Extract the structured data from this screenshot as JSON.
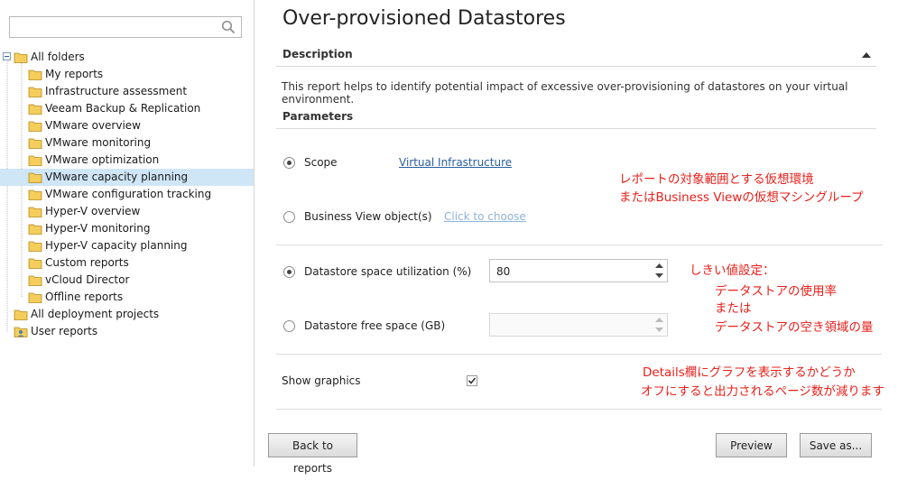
{
  "sidebar": {
    "search": {
      "value": "",
      "placeholder": ""
    },
    "tree": [
      {
        "label": "All folders",
        "level": 0,
        "expanded": true
      },
      {
        "label": "My reports",
        "level": 1
      },
      {
        "label": "Infrastructure assessment",
        "level": 1
      },
      {
        "label": "Veeam Backup & Replication",
        "level": 1
      },
      {
        "label": "VMware overview",
        "level": 1
      },
      {
        "label": "VMware monitoring",
        "level": 1
      },
      {
        "label": "VMware optimization",
        "level": 1
      },
      {
        "label": "VMware capacity planning",
        "level": 1,
        "selected": true
      },
      {
        "label": "VMware configuration tracking",
        "level": 1
      },
      {
        "label": "Hyper-V overview",
        "level": 1
      },
      {
        "label": "Hyper-V monitoring",
        "level": 1
      },
      {
        "label": "Hyper-V capacity planning",
        "level": 1
      },
      {
        "label": "Custom reports",
        "level": 1
      },
      {
        "label": "vCloud Director",
        "level": 1
      },
      {
        "label": "Offline reports",
        "level": 1
      },
      {
        "label": "All deployment projects",
        "level": 0
      },
      {
        "label": "User reports",
        "level": 0,
        "icon": "user-folder"
      }
    ]
  },
  "main": {
    "title": "Over-provisioned Datastores",
    "description": {
      "header": "Description",
      "text": "This report helps to identify potential impact of excessive over-provisioning of datastores on your virtual environment."
    },
    "parameters": {
      "header": "Parameters",
      "scope_label": "Scope",
      "scope_link": "Virtual Infrastructure",
      "bv_label": "Business View object(s)",
      "bv_link": "Click to choose",
      "util_label": "Datastore space utilization (%)",
      "util_value": "80",
      "free_label": "Datastore free space (GB)",
      "free_value": "",
      "graphics_label": "Show graphics",
      "graphics_checked": true
    }
  },
  "annotations": {
    "scope_1": "レポートの対象範囲とする仮想環境",
    "scope_2": "またはBusiness Viewの仮想マシングループ",
    "threshold_1": "しきい値設定：",
    "threshold_2": "データストアの使用率",
    "threshold_3": "または",
    "threshold_4": "データストアの空き領域の量",
    "graphics_1": "Details欄にグラフを表示するかどうか",
    "graphics_2": "オフにすると出力されるページ数が減ります"
  },
  "buttons": {
    "back": "Back to reports",
    "preview": "Preview",
    "save_as": "Save as..."
  },
  "colors": {
    "selection": "#cfe6f7",
    "folder": "#f2c14e",
    "link": "#2a5f9e",
    "annotation": "#e8201a"
  },
  "icons": {
    "search": "search-icon",
    "folder": "folder-icon",
    "expander": "minus-box-icon",
    "collapse": "triangle-up-icon",
    "check": "checkmark-icon"
  }
}
